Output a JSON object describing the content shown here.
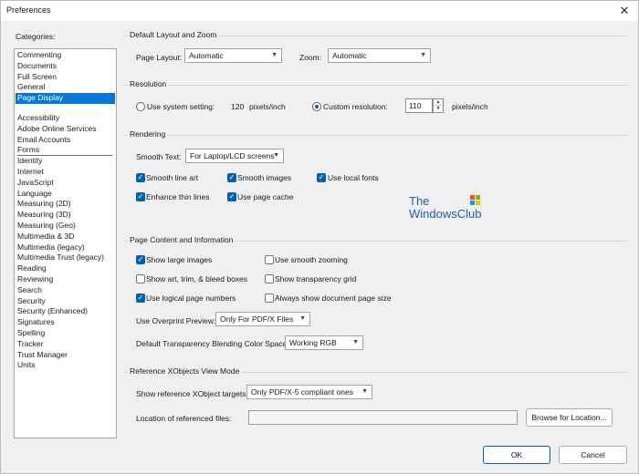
{
  "window": {
    "title": "Preferences",
    "close_glyph": "✕"
  },
  "categories": {
    "label": "Categories:",
    "top": [
      "Commenting",
      "Documents",
      "Full Screen",
      "General",
      "Page Display"
    ],
    "rest": [
      "Accessibility",
      "Adobe Online Services",
      "Email Accounts",
      "Forms",
      "Identity",
      "Internet",
      "JavaScript",
      "Language",
      "Measuring (2D)",
      "Measuring (3D)",
      "Measuring (Geo)",
      "Multimedia & 3D",
      "Multimedia (legacy)",
      "Multimedia Trust (legacy)",
      "Reading",
      "Reviewing",
      "Search",
      "Security",
      "Security (Enhanced)",
      "Signatures",
      "Spelling",
      "Tracker",
      "Trust Manager",
      "Units"
    ],
    "selected": "Page Display"
  },
  "layout_zoom": {
    "title": "Default Layout and Zoom",
    "page_layout_label": "Page Layout:",
    "page_layout_value": "Automatic",
    "zoom_label": "Zoom:",
    "zoom_value": "Automatic"
  },
  "resolution": {
    "title": "Resolution",
    "system_label": "Use system setting:",
    "system_value": "120",
    "system_unit": "pixels/inch",
    "custom_label": "Custom resolution:",
    "custom_value": "110",
    "custom_unit": "pixels/inch",
    "selected": "custom"
  },
  "rendering": {
    "title": "Rendering",
    "smooth_text_label": "Smooth Text:",
    "smooth_text_value": "For Laptop/LCD screens",
    "smooth_line_art": "Smooth line art",
    "smooth_images": "Smooth images",
    "use_local_fonts": "Use local fonts",
    "enhance_thin_lines": "Enhance thin lines",
    "use_page_cache": "Use page cache"
  },
  "page_content": {
    "title": "Page Content and Information",
    "show_large_images": "Show large images",
    "use_smooth_zooming": "Use smooth zooming",
    "show_art_trim": "Show art, trim, & bleed boxes",
    "show_transparency_grid": "Show transparency grid",
    "use_logical_page_numbers": "Use logical page numbers",
    "always_show_page_size": "Always show document page size",
    "overprint_label": "Use Overprint Preview:",
    "overprint_value": "Only For PDF/X Files",
    "blending_label": "Default Transparency Blending Color Space:",
    "blending_value": "Working RGB"
  },
  "xobjects": {
    "title": "Reference XObjects View Mode",
    "targets_label": "Show reference XObject targets:",
    "targets_value": "Only PDF/X-5 compliant ones",
    "location_label": "Location of referenced files:",
    "location_value": "",
    "browse_label": "Browse for Location..."
  },
  "watermark": {
    "line1": "The",
    "line2": "WindowsClub"
  },
  "footer": {
    "ok_label": "OK",
    "cancel_label": "Cancel"
  },
  "colors": {
    "accent": "#0078d7",
    "check": "#0063b1"
  },
  "icons": {
    "close": "close-icon",
    "dropdown": "chevron-down-icon",
    "check": "checkmark-icon",
    "spin_up": "spin-up-icon",
    "spin_down": "spin-down-icon",
    "logo": "windows-logo-icon"
  }
}
